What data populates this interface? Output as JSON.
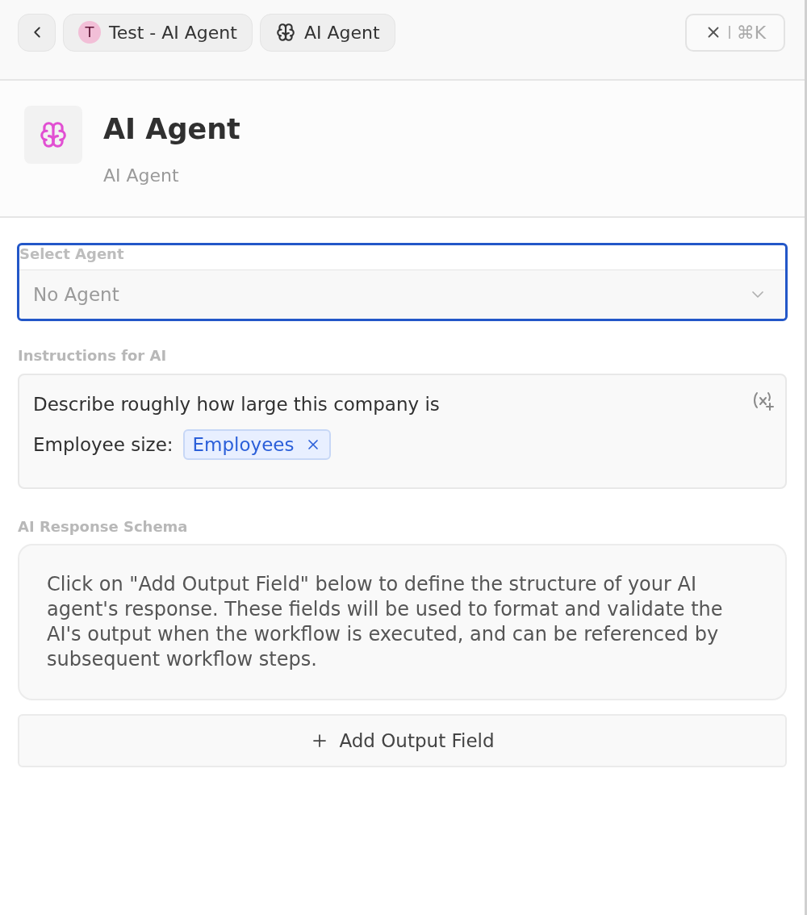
{
  "top_bar": {
    "breadcrumbs": [
      {
        "kind": "avatar",
        "avatar_letter": "T",
        "label": "Test - AI Agent"
      },
      {
        "kind": "brain",
        "label": "AI Agent"
      }
    ],
    "close_button": {
      "shortcut": "⌘K"
    }
  },
  "node": {
    "title": "AI Agent",
    "subtitle": "AI Agent"
  },
  "select_agent": {
    "label": "Select Agent",
    "value": "No Agent",
    "focused": true
  },
  "instructions": {
    "label": "Instructions for AI",
    "lines": [
      {
        "parts": [
          {
            "kind": "text",
            "text": "Describe roughly how large this company is"
          }
        ]
      },
      {
        "parts": [
          {
            "kind": "text",
            "text": "Employee size:"
          },
          {
            "kind": "variable",
            "text": "Employees"
          }
        ]
      }
    ]
  },
  "response_schema": {
    "label": "AI Response Schema",
    "message": "Click on \"Add Output Field\" below to define the structure of your AI agent's response. These fields will be used to format and validate the AI's output when the workflow is executed, and can be referenced by subsequent workflow steps."
  },
  "add_button": {
    "label": "Add Output Field"
  }
}
